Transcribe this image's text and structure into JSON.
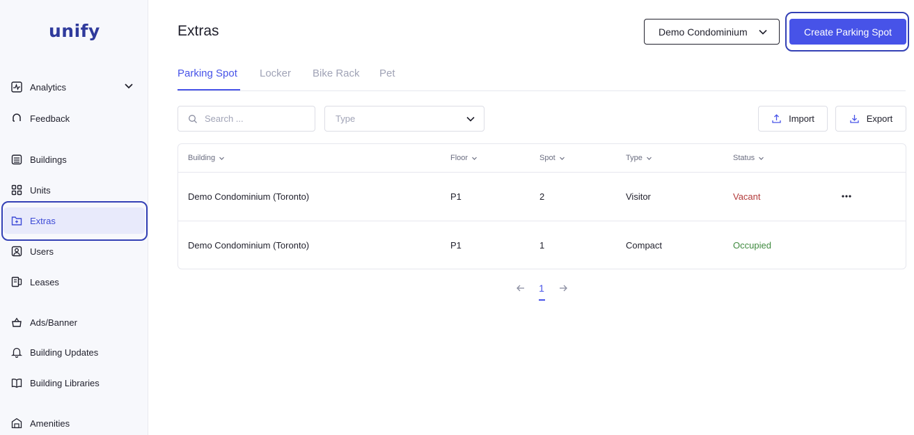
{
  "app": {
    "logo": "unify"
  },
  "colors": {
    "accent": "#4753e8",
    "vacant": "#b23a3a",
    "occupied": "#3f8a3f",
    "highlight_outline": "#3340b5"
  },
  "sidebar": {
    "items": [
      {
        "label": "Analytics",
        "icon": "analytics-icon",
        "has_chevron": true
      },
      {
        "label": "Feedback",
        "icon": "feedback-icon"
      },
      {
        "label": "Buildings",
        "icon": "buildings-icon"
      },
      {
        "label": "Units",
        "icon": "units-icon"
      },
      {
        "label": "Extras",
        "icon": "extras-icon",
        "active": true
      },
      {
        "label": "Users",
        "icon": "users-icon"
      },
      {
        "label": "Leases",
        "icon": "leases-icon"
      },
      {
        "label": "Ads/Banner",
        "icon": "ads-icon"
      },
      {
        "label": "Building Updates",
        "icon": "bell-icon"
      },
      {
        "label": "Building Libraries",
        "icon": "book-icon"
      },
      {
        "label": "Amenities",
        "icon": "amenities-icon"
      }
    ]
  },
  "header": {
    "title": "Extras",
    "building_select": "Demo Condominium",
    "create_label": "Create Parking Spot"
  },
  "tabs": [
    {
      "label": "Parking Spot",
      "active": true
    },
    {
      "label": "Locker"
    },
    {
      "label": "Bike Rack"
    },
    {
      "label": "Pet"
    }
  ],
  "filters": {
    "search_placeholder": "Search ...",
    "type_placeholder": "Type",
    "import_label": "Import",
    "export_label": "Export"
  },
  "table": {
    "columns": [
      "Building",
      "Floor",
      "Spot",
      "Type",
      "Status"
    ],
    "rows": [
      {
        "building": "Demo Condominium (Toronto)",
        "floor": "P1",
        "spot": "2",
        "type": "Visitor",
        "status": "Vacant"
      },
      {
        "building": "Demo Condominium (Toronto)",
        "floor": "P1",
        "spot": "1",
        "type": "Compact",
        "status": "Occupied"
      }
    ]
  },
  "pagination": {
    "current_page": "1"
  }
}
